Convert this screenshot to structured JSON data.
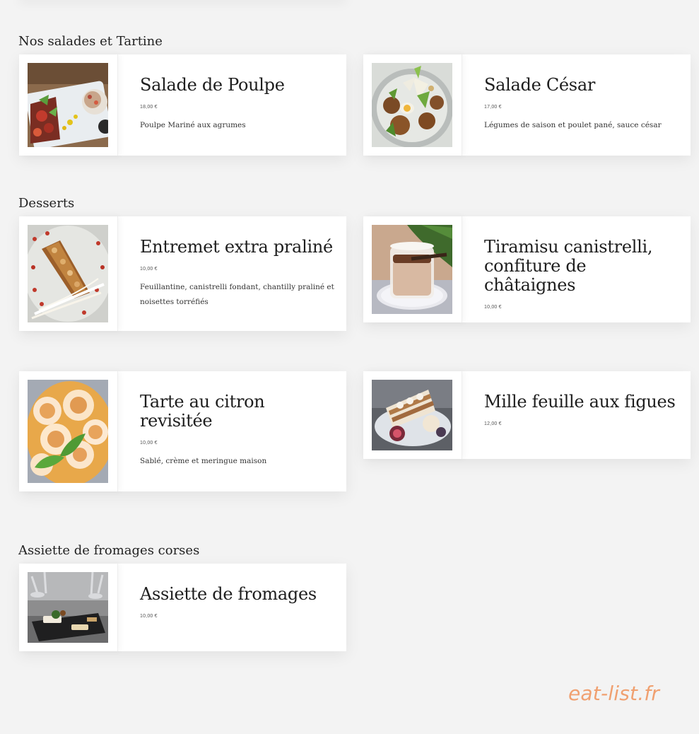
{
  "sections": [
    {
      "title": "Nos salades et Tartine",
      "items": [
        {
          "name": "Salade de Poulpe",
          "price": "18,00 €",
          "description": "Poulpe Mariné aux agrumes",
          "image": "octopus-salad-photo"
        },
        {
          "name": "Salade César",
          "price": "17,00 €",
          "description": "Légumes de saison et poulet pané, sauce césar",
          "image": "caesar-salad-photo"
        }
      ]
    },
    {
      "title": "Desserts",
      "items": [
        {
          "name": "Entremet extra praliné",
          "price": "10,00 €",
          "description": "Feuillantine, canistrelli fondant, chantilly praliné et noisettes torréfiés",
          "image": "praline-entremet-photo"
        },
        {
          "name": "Tiramisu canistrelli, confiture de châtaignes",
          "price": "10,00 €",
          "description": "",
          "image": "tiramisu-photo"
        },
        {
          "name": "Tarte au citron revisitée",
          "price": "10,00 €",
          "description": "Sablé, crème et meringue maison",
          "image": "lemon-tart-photo"
        },
        {
          "name": "Mille feuille aux figues",
          "price": "12,00 €",
          "description": "",
          "image": "fig-millefeuille-photo"
        }
      ]
    },
    {
      "title": "Assiette de fromages corses",
      "items": [
        {
          "name": "Assiette de fromages",
          "price": "10,00 €",
          "description": "",
          "image": "cheese-plate-photo"
        }
      ]
    }
  ],
  "watermark": "eat-list.fr"
}
